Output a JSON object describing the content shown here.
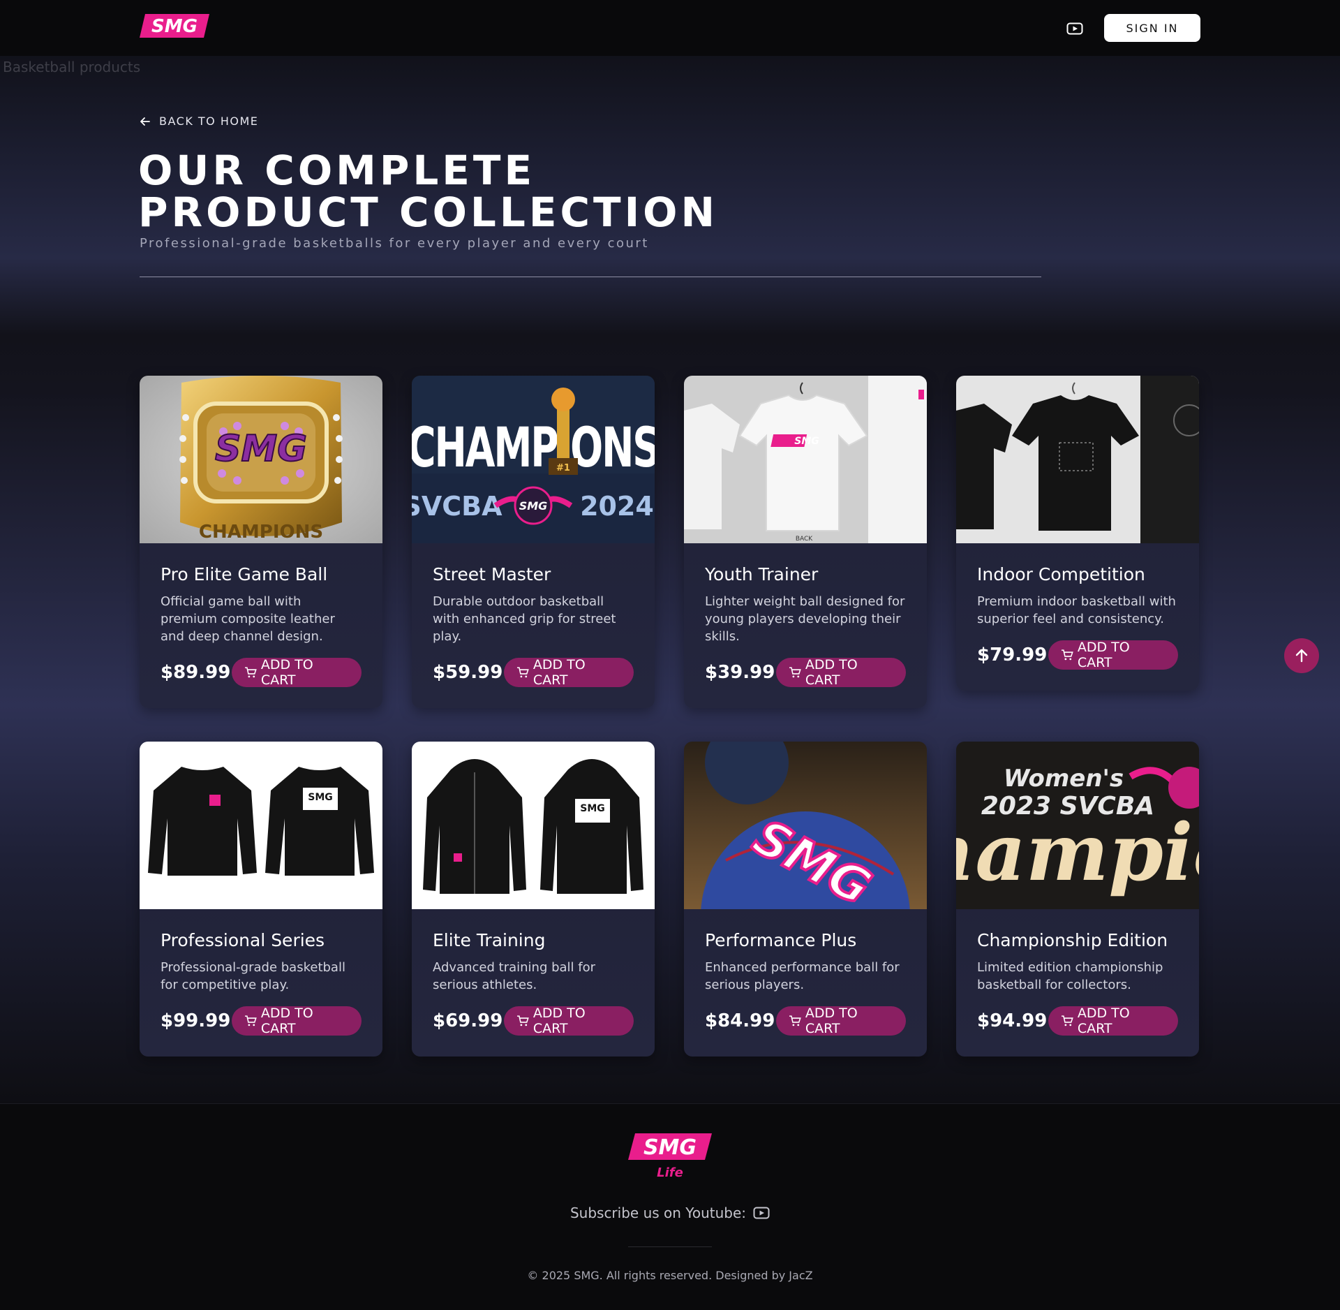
{
  "header": {
    "logo_text": "SMG",
    "signin_label": "SIGN IN",
    "broken_image_alt": "Basketball products"
  },
  "hero": {
    "back_label": "BACK TO HOME",
    "title_line1": "OUR COMPLETE",
    "title_line2": "PRODUCT COLLECTION",
    "subtitle": "Professional-grade basketballs for every player and every court"
  },
  "products": [
    {
      "name": "Pro Elite Game Ball",
      "description": "Official game ball with premium composite leather and deep channel design.",
      "price": "$89.99",
      "cart_label": "ADD TO CART"
    },
    {
      "name": "Street Master",
      "description": "Durable outdoor basketball with enhanced grip for street play.",
      "price": "$59.99",
      "cart_label": "ADD TO CART"
    },
    {
      "name": "Youth Trainer",
      "description": "Lighter weight ball designed for young players developing their skills.",
      "price": "$39.99",
      "cart_label": "ADD TO CART"
    },
    {
      "name": "Indoor Competition",
      "description": "Premium indoor basketball with superior feel and consistency.",
      "price": "$79.99",
      "cart_label": "ADD TO CART"
    },
    {
      "name": "Professional Series",
      "description": "Professional-grade basketball for competitive play.",
      "price": "$99.99",
      "cart_label": "ADD TO CART"
    },
    {
      "name": "Elite Training",
      "description": "Advanced training ball for serious athletes.",
      "price": "$69.99",
      "cart_label": "ADD TO CART"
    },
    {
      "name": "Performance Plus",
      "description": "Enhanced performance ball for serious players.",
      "price": "$84.99",
      "cart_label": "ADD TO CART"
    },
    {
      "name": "Championship Edition",
      "description": "Limited edition championship basketball for collectors.",
      "price": "$94.99",
      "cart_label": "ADD TO CART"
    }
  ],
  "product_images": {
    "img1_ring_text": "SMG",
    "img1_ring_band": "CHAMPIONS",
    "img2_banner": "CHAMPIONS",
    "img2_left": "SVCBA",
    "img2_right": "2024",
    "img2_badge": "SMG",
    "img2_trophy_label": "#1",
    "img3_shirt_logo": "SMG",
    "img3_back_label": "BACK",
    "img5_print": "SMG",
    "img6_print": "SMG",
    "img7_ball": "SMG",
    "img8_line1": "Women's",
    "img8_line2": "2023 SVCBA",
    "img8_script": "hampio"
  },
  "footer": {
    "logo_text": "SMG",
    "logo_sub": "Life",
    "subscribe_label": "Subscribe us on Youtube:",
    "copyright": "© 2025 SMG. All rights reserved. Designed by JacZ"
  },
  "colors": {
    "accent": "#8a1f62",
    "brand_pink": "#e91e8c",
    "background": "#0a0a0c"
  },
  "icons": {
    "youtube": "youtube-icon",
    "back": "arrow-left-icon",
    "cart": "cart-icon",
    "top": "arrow-up-icon"
  }
}
